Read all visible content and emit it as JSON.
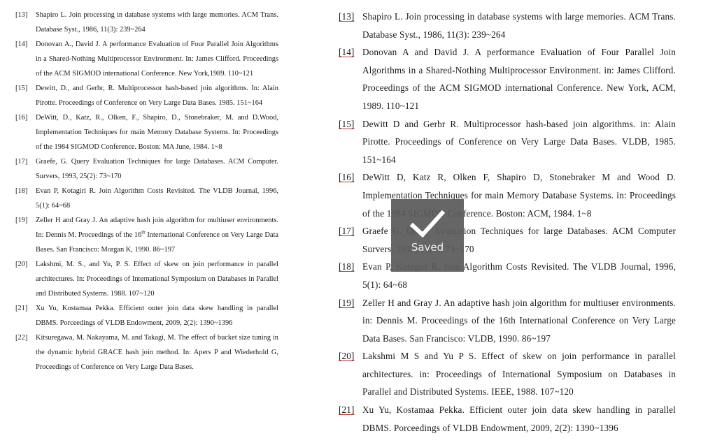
{
  "left_column": {
    "refs": [
      {
        "num": "[13]",
        "text": "Shapiro L. Join processing in database systems with large memories. ACM Trans. Database Syst., 1986, 11(3): 239~264"
      },
      {
        "num": "[14]",
        "text": "Donovan A., David J. A performance Evaluation of Four Parallel Join Algorithms in a Shared-Nothing Multiprocessor Environment. In: James Clifford. Proceedings of the ACM SIGMOD international Conference. New York,1989. 110~121"
      },
      {
        "num": "[15]",
        "text": "Dewitt, D., and Gerbr, R. Multiprocessor hash-based join algorithms. In: Alain Pirotte. Proceedings of Conference on Very Large Data Bases. 1985. 151~164"
      },
      {
        "num": "[16]",
        "text": "DeWitt, D., Katz, R., Olken, F., Shapiro, D., Stonebraker, M. and D.Wood, Implementation Techniques for main Memory Database Systems. In: Proceedings of the 1984 SIGMOD Conference. Boston: MA June, 1984. 1~8"
      },
      {
        "num": "[17]",
        "text": "Graefe, G. Query Evaluation Techniques for large Databases. ACM Computer. Survers, 1993, 25(2): 73~170"
      },
      {
        "num": "[18]",
        "text": "Evan P, Kotagiri R. Join Algorithm Costs Revisited. The VLDB Journal, 1996, 5(1): 64~68"
      },
      {
        "num": "[19]",
        "text_before_sup": "Zeller H and Gray J. An adaptive hash join algorithm for multiuser environments. In: Dennis M. Proceedings of the 16",
        "sup": "th",
        "text_after_sup": " International Conference on Very Large Data Bases. San Francisco: Morgan K, 1990. 86~197"
      },
      {
        "num": "[20]",
        "text": "Lakshmi, M. S., and Yu, P. S. Effect of skew on join performance in parallel architectures. In: Proceedings of International Symposium on Databases in Parallel and Distributed Systems. 1988. 107~120"
      },
      {
        "num": "[21]",
        "text": "Xu Yu, Kostamaa Pekka. Efficient outer join data skew handling in parallel DBMS. Porceedings of VLDB Endowment, 2009, 2(2): 1390~1396"
      },
      {
        "num": "[22]",
        "text": "Kitsuregawa, M. Nakayama, M. and Takagi, M. The effect of bucket size tuning in the dynamic hybrid GRACE hash join method. In: Apers P and Wiederhold G,     Proceedings of Conference on Very Large Data Bases."
      }
    ]
  },
  "right_column": {
    "refs": [
      {
        "num": "[13]",
        "text": "Shapiro L. Join processing in database systems with large memories. ACM Trans. Database Syst., 1986, 11(3): 239~264"
      },
      {
        "num": "[14]",
        "text": "Donovan A and David J. A performance Evaluation of Four Parallel Join Algorithms in a Shared-Nothing Multiprocessor Environment. in: James Clifford. Proceedings of the ACM SIGMOD international Conference. New York, ACM, 1989. 110~121"
      },
      {
        "num": "[15]",
        "text": "Dewitt D and Gerbr R. Multiprocessor hash-based join algorithms. in: Alain Pirotte. Proceedings of Conference on Very Large Data Bases. VLDB, 1985. 151~164"
      },
      {
        "num": "[16]",
        "text": "DeWitt D, Katz R, Olken F, Shapiro D, Stonebraker M and Wood D. Implementation Techniques for main Memory Database Systems. in: Proceedings of the 1984 SIGMOD Conference. Boston: ACM, 1984. 1~8"
      },
      {
        "num": "[17]",
        "text": "Graefe G. Query Evaluation Techniques for large Databases. ACM Computer Survers, 1993, 25(2): 73~170"
      },
      {
        "num": "[18]",
        "text": "Evan P, Kotagiri R. Join Algorithm Costs Revisited. The VLDB Journal, 1996, 5(1): 64~68"
      },
      {
        "num": "[19]",
        "text": "Zeller H and Gray J. An adaptive hash join algorithm for multiuser environments. in: Dennis M. Proceedings of the 16th International Conference on Very Large Data Bases. San Francisco: VLDB, 1990. 86~197"
      },
      {
        "num": "[20]",
        "text": "Lakshmi M S and Yu P S. Effect of skew on join performance in parallel architectures. in: Proceedings of International Symposium on Databases in Parallel and Distributed Systems. IEEE, 1988. 107~120"
      },
      {
        "num": "[21]",
        "text": "Xu Yu, Kostamaa Pekka. Efficient outer join data skew handling in parallel DBMS. Porceedings of VLDB Endowment, 2009, 2(2): 1390~1396"
      }
    ]
  },
  "toast": {
    "icon": "checkmark-icon",
    "label": "Saved"
  },
  "colors": {
    "toast_bg": "#5a5a5a",
    "ref_underline": "#c0392b"
  }
}
